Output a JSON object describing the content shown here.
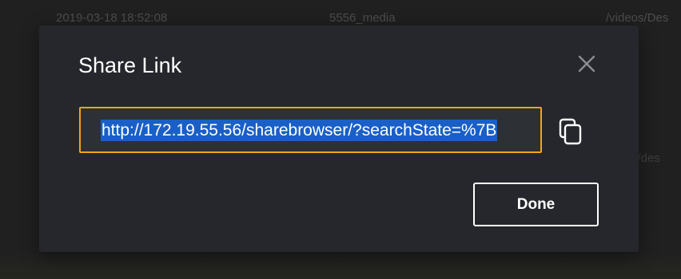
{
  "background": {
    "row": {
      "date": "2019-03-18 18:52:08",
      "name": "5556_media",
      "path": "/videos/Des"
    },
    "row2_path": "s/des"
  },
  "modal": {
    "title": "Share Link",
    "close_icon": "close-icon",
    "link": {
      "value": "http://172.19.55.56/sharebrowser/?searchState=%7B",
      "selected": true
    },
    "copy_icon": "copy-icon",
    "done_label": "Done"
  },
  "colors": {
    "page_background": "#202020",
    "modal_background": "#25272c",
    "field_background": "#2d3034",
    "focus_border": "#f2a516",
    "selection": "#1a5fc6",
    "text": "#ffffff",
    "icon": "#8a8d93"
  }
}
